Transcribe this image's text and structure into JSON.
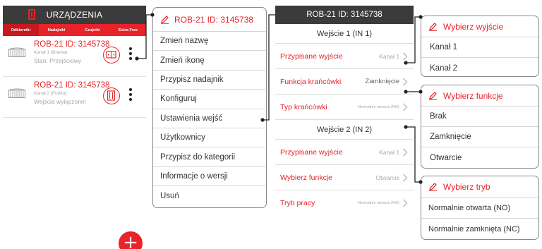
{
  "devices_screen": {
    "title": "URZĄDZENIA",
    "tabs": [
      "Odbiorniki",
      "Nadajniki",
      "Czujniki",
      "Extra Free"
    ],
    "devices": [
      {
        "title": "ROB-21 ID: 3145738",
        "channel": "Kanał 1 (Brama)",
        "status": "Stan: Przejściowy"
      },
      {
        "title": "ROB-21 ID: 3145738",
        "channel": "Kanał 2 (Furtka)",
        "status": "Wejścia wyłączone!"
      }
    ],
    "fab_label": "+"
  },
  "device_menu": {
    "title": "ROB-21 ID: 3145738",
    "items": [
      "Zmień nazwę",
      "Zmień ikonę",
      "Przypisz nadajnik",
      "Konfiguruj",
      "Ustawienia wejść",
      "Użytkownicy",
      "Przypisz do kategorii",
      "Informacje o wersji",
      "Usuń"
    ]
  },
  "inputs_screen": {
    "title": "ROB-21 ID: 3145738",
    "input1": {
      "header": "Wejście 1 (IN 1)",
      "rows": [
        {
          "label": "Przypisane wyjście",
          "value": "Kanał 1"
        },
        {
          "label": "Funkcja krańcówki",
          "value": "Zamknięcie"
        },
        {
          "label": "Typ krańcówki",
          "value": "Normalnie otwarta (NO)"
        }
      ]
    },
    "input2": {
      "header": "Wejście 2 (IN 2)",
      "rows": [
        {
          "label": "Przypisane wyjście",
          "value": "Kanał 1"
        },
        {
          "label": "Wybierz funkcje",
          "value": "Otwarcie"
        },
        {
          "label": "Tryb pracy",
          "value": "Normalnie otwarta (NO)"
        }
      ]
    }
  },
  "popup_output": {
    "title": "Wybierz wyjście",
    "options": [
      "Kanał 1",
      "Kanał 2"
    ]
  },
  "popup_function": {
    "title": "Wybierz funkcje",
    "options": [
      "Brak",
      "Zamknięcie",
      "Otwarcie"
    ]
  },
  "popup_mode": {
    "title": "Wybierz tryb",
    "options": [
      "Normalnie otwarta (NO)",
      "Normalnie zamknięta (NC)"
    ]
  },
  "colors": {
    "accent": "#e8232a",
    "topbar": "#3b3b3b",
    "muted_text": "#a6a6a6"
  }
}
